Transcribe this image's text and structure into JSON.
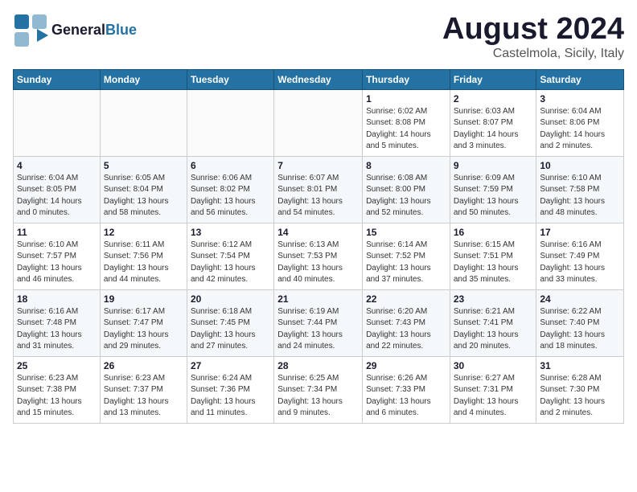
{
  "logo": {
    "general": "General",
    "blue": "Blue",
    "tagline": ""
  },
  "header": {
    "month": "August 2024",
    "location": "Castelmola, Sicily, Italy"
  },
  "weekdays": [
    "Sunday",
    "Monday",
    "Tuesday",
    "Wednesday",
    "Thursday",
    "Friday",
    "Saturday"
  ],
  "weeks": [
    [
      {
        "day": "",
        "info": ""
      },
      {
        "day": "",
        "info": ""
      },
      {
        "day": "",
        "info": ""
      },
      {
        "day": "",
        "info": ""
      },
      {
        "day": "1",
        "info": "Sunrise: 6:02 AM\nSunset: 8:08 PM\nDaylight: 14 hours\nand 5 minutes."
      },
      {
        "day": "2",
        "info": "Sunrise: 6:03 AM\nSunset: 8:07 PM\nDaylight: 14 hours\nand 3 minutes."
      },
      {
        "day": "3",
        "info": "Sunrise: 6:04 AM\nSunset: 8:06 PM\nDaylight: 14 hours\nand 2 minutes."
      }
    ],
    [
      {
        "day": "4",
        "info": "Sunrise: 6:04 AM\nSunset: 8:05 PM\nDaylight: 14 hours\nand 0 minutes."
      },
      {
        "day": "5",
        "info": "Sunrise: 6:05 AM\nSunset: 8:04 PM\nDaylight: 13 hours\nand 58 minutes."
      },
      {
        "day": "6",
        "info": "Sunrise: 6:06 AM\nSunset: 8:02 PM\nDaylight: 13 hours\nand 56 minutes."
      },
      {
        "day": "7",
        "info": "Sunrise: 6:07 AM\nSunset: 8:01 PM\nDaylight: 13 hours\nand 54 minutes."
      },
      {
        "day": "8",
        "info": "Sunrise: 6:08 AM\nSunset: 8:00 PM\nDaylight: 13 hours\nand 52 minutes."
      },
      {
        "day": "9",
        "info": "Sunrise: 6:09 AM\nSunset: 7:59 PM\nDaylight: 13 hours\nand 50 minutes."
      },
      {
        "day": "10",
        "info": "Sunrise: 6:10 AM\nSunset: 7:58 PM\nDaylight: 13 hours\nand 48 minutes."
      }
    ],
    [
      {
        "day": "11",
        "info": "Sunrise: 6:10 AM\nSunset: 7:57 PM\nDaylight: 13 hours\nand 46 minutes."
      },
      {
        "day": "12",
        "info": "Sunrise: 6:11 AM\nSunset: 7:56 PM\nDaylight: 13 hours\nand 44 minutes."
      },
      {
        "day": "13",
        "info": "Sunrise: 6:12 AM\nSunset: 7:54 PM\nDaylight: 13 hours\nand 42 minutes."
      },
      {
        "day": "14",
        "info": "Sunrise: 6:13 AM\nSunset: 7:53 PM\nDaylight: 13 hours\nand 40 minutes."
      },
      {
        "day": "15",
        "info": "Sunrise: 6:14 AM\nSunset: 7:52 PM\nDaylight: 13 hours\nand 37 minutes."
      },
      {
        "day": "16",
        "info": "Sunrise: 6:15 AM\nSunset: 7:51 PM\nDaylight: 13 hours\nand 35 minutes."
      },
      {
        "day": "17",
        "info": "Sunrise: 6:16 AM\nSunset: 7:49 PM\nDaylight: 13 hours\nand 33 minutes."
      }
    ],
    [
      {
        "day": "18",
        "info": "Sunrise: 6:16 AM\nSunset: 7:48 PM\nDaylight: 13 hours\nand 31 minutes."
      },
      {
        "day": "19",
        "info": "Sunrise: 6:17 AM\nSunset: 7:47 PM\nDaylight: 13 hours\nand 29 minutes."
      },
      {
        "day": "20",
        "info": "Sunrise: 6:18 AM\nSunset: 7:45 PM\nDaylight: 13 hours\nand 27 minutes."
      },
      {
        "day": "21",
        "info": "Sunrise: 6:19 AM\nSunset: 7:44 PM\nDaylight: 13 hours\nand 24 minutes."
      },
      {
        "day": "22",
        "info": "Sunrise: 6:20 AM\nSunset: 7:43 PM\nDaylight: 13 hours\nand 22 minutes."
      },
      {
        "day": "23",
        "info": "Sunrise: 6:21 AM\nSunset: 7:41 PM\nDaylight: 13 hours\nand 20 minutes."
      },
      {
        "day": "24",
        "info": "Sunrise: 6:22 AM\nSunset: 7:40 PM\nDaylight: 13 hours\nand 18 minutes."
      }
    ],
    [
      {
        "day": "25",
        "info": "Sunrise: 6:23 AM\nSunset: 7:38 PM\nDaylight: 13 hours\nand 15 minutes."
      },
      {
        "day": "26",
        "info": "Sunrise: 6:23 AM\nSunset: 7:37 PM\nDaylight: 13 hours\nand 13 minutes."
      },
      {
        "day": "27",
        "info": "Sunrise: 6:24 AM\nSunset: 7:36 PM\nDaylight: 13 hours\nand 11 minutes."
      },
      {
        "day": "28",
        "info": "Sunrise: 6:25 AM\nSunset: 7:34 PM\nDaylight: 13 hours\nand 9 minutes."
      },
      {
        "day": "29",
        "info": "Sunrise: 6:26 AM\nSunset: 7:33 PM\nDaylight: 13 hours\nand 6 minutes."
      },
      {
        "day": "30",
        "info": "Sunrise: 6:27 AM\nSunset: 7:31 PM\nDaylight: 13 hours\nand 4 minutes."
      },
      {
        "day": "31",
        "info": "Sunrise: 6:28 AM\nSunset: 7:30 PM\nDaylight: 13 hours\nand 2 minutes."
      }
    ]
  ]
}
